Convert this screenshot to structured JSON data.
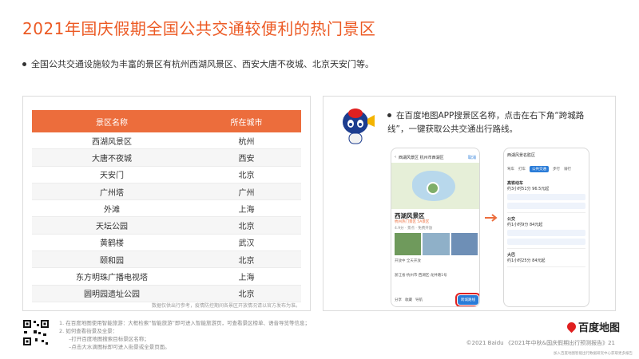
{
  "page": {
    "title": "2021年国庆假期全国公共交通较便利的热门景区",
    "bullet": "全国公共交通设施较为丰富的景区有杭州西湖风景区、西安大唐不夜城、北京天安门等。"
  },
  "table": {
    "headers": [
      "景区名称",
      "所在城市"
    ],
    "rows": [
      [
        "西湖风景区",
        "杭州"
      ],
      [
        "大唐不夜城",
        "西安"
      ],
      [
        "天安门",
        "北京"
      ],
      [
        "广州塔",
        "广州"
      ],
      [
        "外滩",
        "上海"
      ],
      [
        "天坛公园",
        "北京"
      ],
      [
        "黄鹤楼",
        "武汉"
      ],
      [
        "颐和园",
        "北京"
      ],
      [
        "东方明珠广播电视塔",
        "上海"
      ],
      [
        "圆明园遗址公园",
        "北京"
      ]
    ],
    "note": "数据仅供出行参考，疫情防控期间各景区开放情况请以官方发布为准。"
  },
  "instruction": "在百度地图APP搜景区名称，点击在右下角“跨城路线”，一键获取公共交通出行路线。",
  "phone1": {
    "search": "西湖风景区 杭州市西湖区",
    "cancel": "取消",
    "name": "西湖风景区",
    "tag": "杭州热门景区 5A景区",
    "sub": "4.9分 · 景点 · 免费开放",
    "info": "开放中 全天开放",
    "addr": "浙江省·杭州市·西湖区·龙井路1号",
    "bar": [
      "分享",
      "收藏",
      "导航"
    ],
    "route": "跨城路线"
  },
  "phone2": {
    "top": "西湖风景名胜区",
    "tabs": [
      "驾车",
      "打车",
      "公共交通",
      "步行",
      "骑行"
    ],
    "items": [
      {
        "head": "高铁动车",
        "val": "约3小时51分 96.5元起"
      },
      {
        "head": "公交",
        "val": "约1小时9分 84元起"
      },
      {
        "head": "大巴",
        "val": "约1小时25分 84元起"
      }
    ]
  },
  "footer": {
    "notes": [
      "1. 在百度地图使用智能旅游：大框检索“智能旅游”即可进入智能旅游页，可查看景区榜单、语音导览等信息；",
      "2. 如何查看街景及全景：",
      "–打开百度地图搜索目标景区名称；",
      "–点击大水滴图标即可进入街景或全景页面。"
    ],
    "brand": "百度地图",
    "credit": "©2021 Baidu 《2021年中秋&国庆假期出行预测报告》21",
    "tiny": "加入百度地图智能出行数据研究中心获取更多报告"
  },
  "colors": {
    "accent": "#ec5a24",
    "header": "#ec6d3c",
    "route": "#2a7cd8"
  }
}
